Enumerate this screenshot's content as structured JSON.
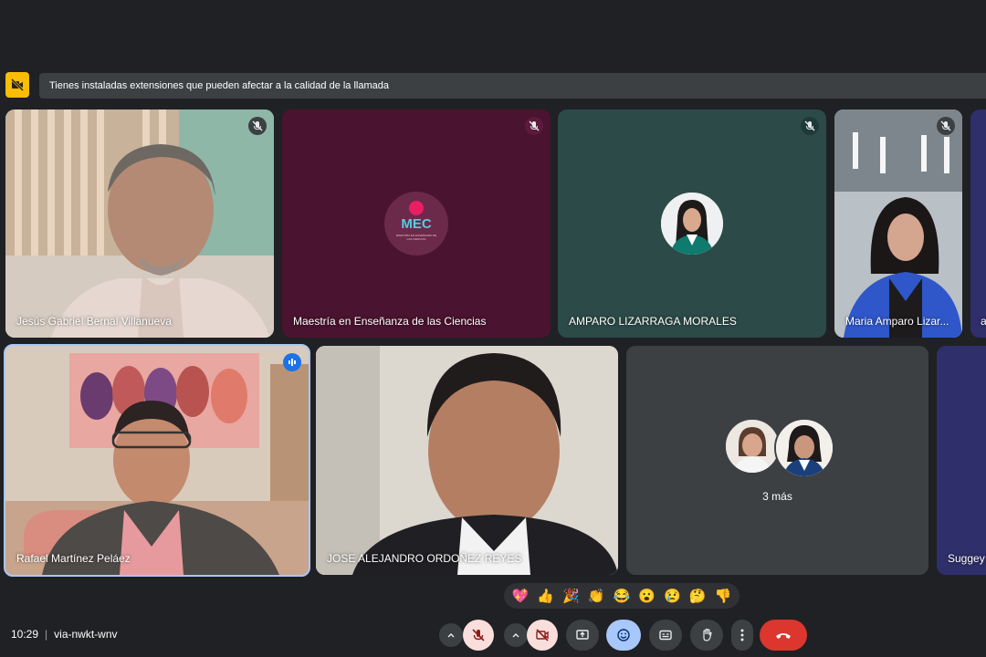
{
  "banner": {
    "text": "Tienes instaladas extensiones que pueden afectar a la calidad de la llamada"
  },
  "participants": [
    {
      "name": "Jesús Gabriel Bernal Villanueva",
      "muted": true
    },
    {
      "name": "Maestría en Enseñanza de las Ciencias",
      "muted": true,
      "logo_text": "MEC",
      "logo_subtext": "MAESTRÍA EN ENSEÑANZA DE LAS CIENCIAS"
    },
    {
      "name": "AMPARO LIZARRAGA MORALES",
      "muted": true
    },
    {
      "name": "Maria Amparo Lizar...",
      "muted": true
    },
    {
      "name": "a"
    },
    {
      "name": "Rafael Martínez Peláez",
      "speaking": true
    },
    {
      "name": "JOSE ALEJANDRO ORDOÑEZ REYES"
    },
    {
      "name": "3 más"
    },
    {
      "name": "Suggey T"
    }
  ],
  "reactions": [
    "💖",
    "👍",
    "🎉",
    "👏",
    "😂",
    "😮",
    "😢",
    "🤔",
    "👎"
  ],
  "footer": {
    "time": "10:29",
    "meeting_code": "via-nwkt-wnv"
  },
  "colors": {
    "background": "#202124",
    "banner_warning": "#fbbc04",
    "tile_maroon": "#4a1330",
    "tile_teal": "#2c4a48",
    "tile_gray": "#3c4043",
    "tile_navy": "#2e2f6b",
    "speaking_border": "#a8c7fa",
    "hangup_red": "#dc362e"
  }
}
